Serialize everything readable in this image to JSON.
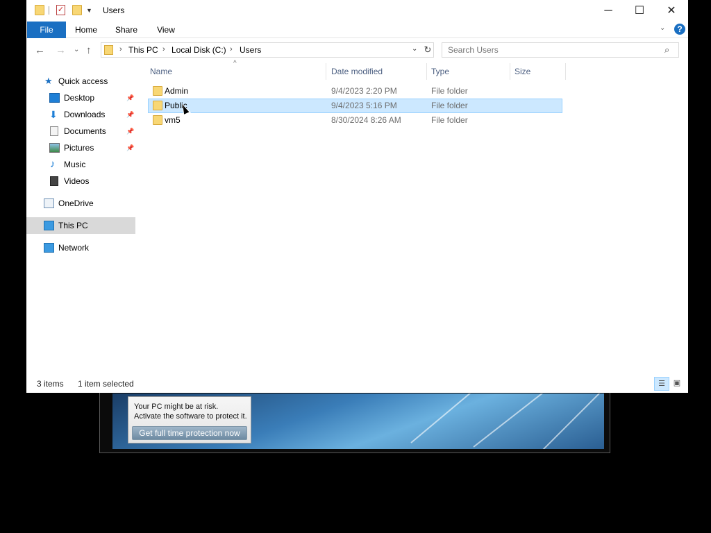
{
  "background_popup": {
    "line1": "Your PC might be at risk.",
    "line2": "Activate the software to protect it.",
    "button_label": "Get full time protection now"
  },
  "window": {
    "title": "Users",
    "minimize_glyph": "─",
    "maximize_glyph": "☐",
    "close_glyph": "✕"
  },
  "ribbon": {
    "tabs": [
      "File",
      "Home",
      "Share",
      "View"
    ],
    "help_glyph": "?"
  },
  "address": {
    "crumbs": [
      "This PC",
      "Local Disk (C:)",
      "Users"
    ],
    "separator": "›"
  },
  "search": {
    "placeholder": "Search Users"
  },
  "nav_pane": {
    "quick_access": "Quick access",
    "items": [
      {
        "label": "Desktop",
        "pinned": true
      },
      {
        "label": "Downloads",
        "pinned": true
      },
      {
        "label": "Documents",
        "pinned": true
      },
      {
        "label": "Pictures",
        "pinned": true
      },
      {
        "label": "Music",
        "pinned": false
      },
      {
        "label": "Videos",
        "pinned": false
      }
    ],
    "onedrive": "OneDrive",
    "this_pc": "This PC",
    "network": "Network"
  },
  "list": {
    "columns": {
      "name": "Name",
      "date": "Date modified",
      "type": "Type",
      "size": "Size"
    },
    "rows": [
      {
        "name": "Admin",
        "date": "9/4/2023 2:20 PM",
        "type": "File folder"
      },
      {
        "name": "Public",
        "date": "9/4/2023 5:16 PM",
        "type": "File folder"
      },
      {
        "name": "vm5",
        "date": "8/30/2024 8:26 AM",
        "type": "File folder"
      }
    ]
  },
  "status": {
    "item_count": "3 items",
    "selection": "1 item selected"
  },
  "colors": {
    "accent": "#1a6fc2",
    "selection_fill": "#cce8ff",
    "selection_border": "#99d1ff"
  }
}
